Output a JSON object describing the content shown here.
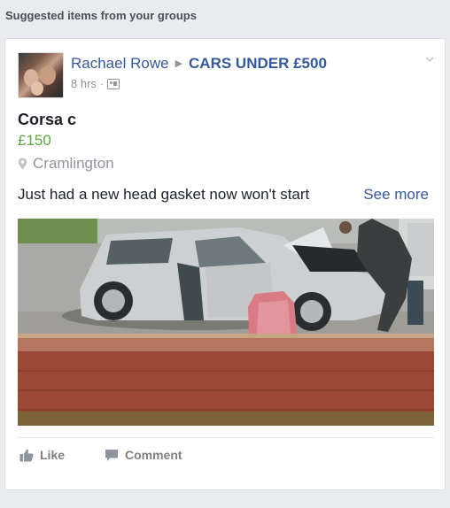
{
  "section": {
    "title": "Suggested items from your groups"
  },
  "post": {
    "author": "Rachael Rowe",
    "group": "CARS UNDER £500",
    "time": "8 hrs",
    "separator": "·",
    "item_title": "Corsa c",
    "price": "£150",
    "location": "Cramlington",
    "description": "Just had a new head gasket now won't start",
    "see_more": "See more"
  },
  "actions": {
    "like": "Like",
    "comment": "Comment"
  },
  "colors": {
    "link": "#365899",
    "price": "#5ba541",
    "muted": "#90949c",
    "background": "#e9ebee"
  },
  "icons": [
    "chevron-down-icon",
    "audience-icon",
    "location-pin-icon",
    "thumbs-up-icon",
    "comment-icon"
  ]
}
